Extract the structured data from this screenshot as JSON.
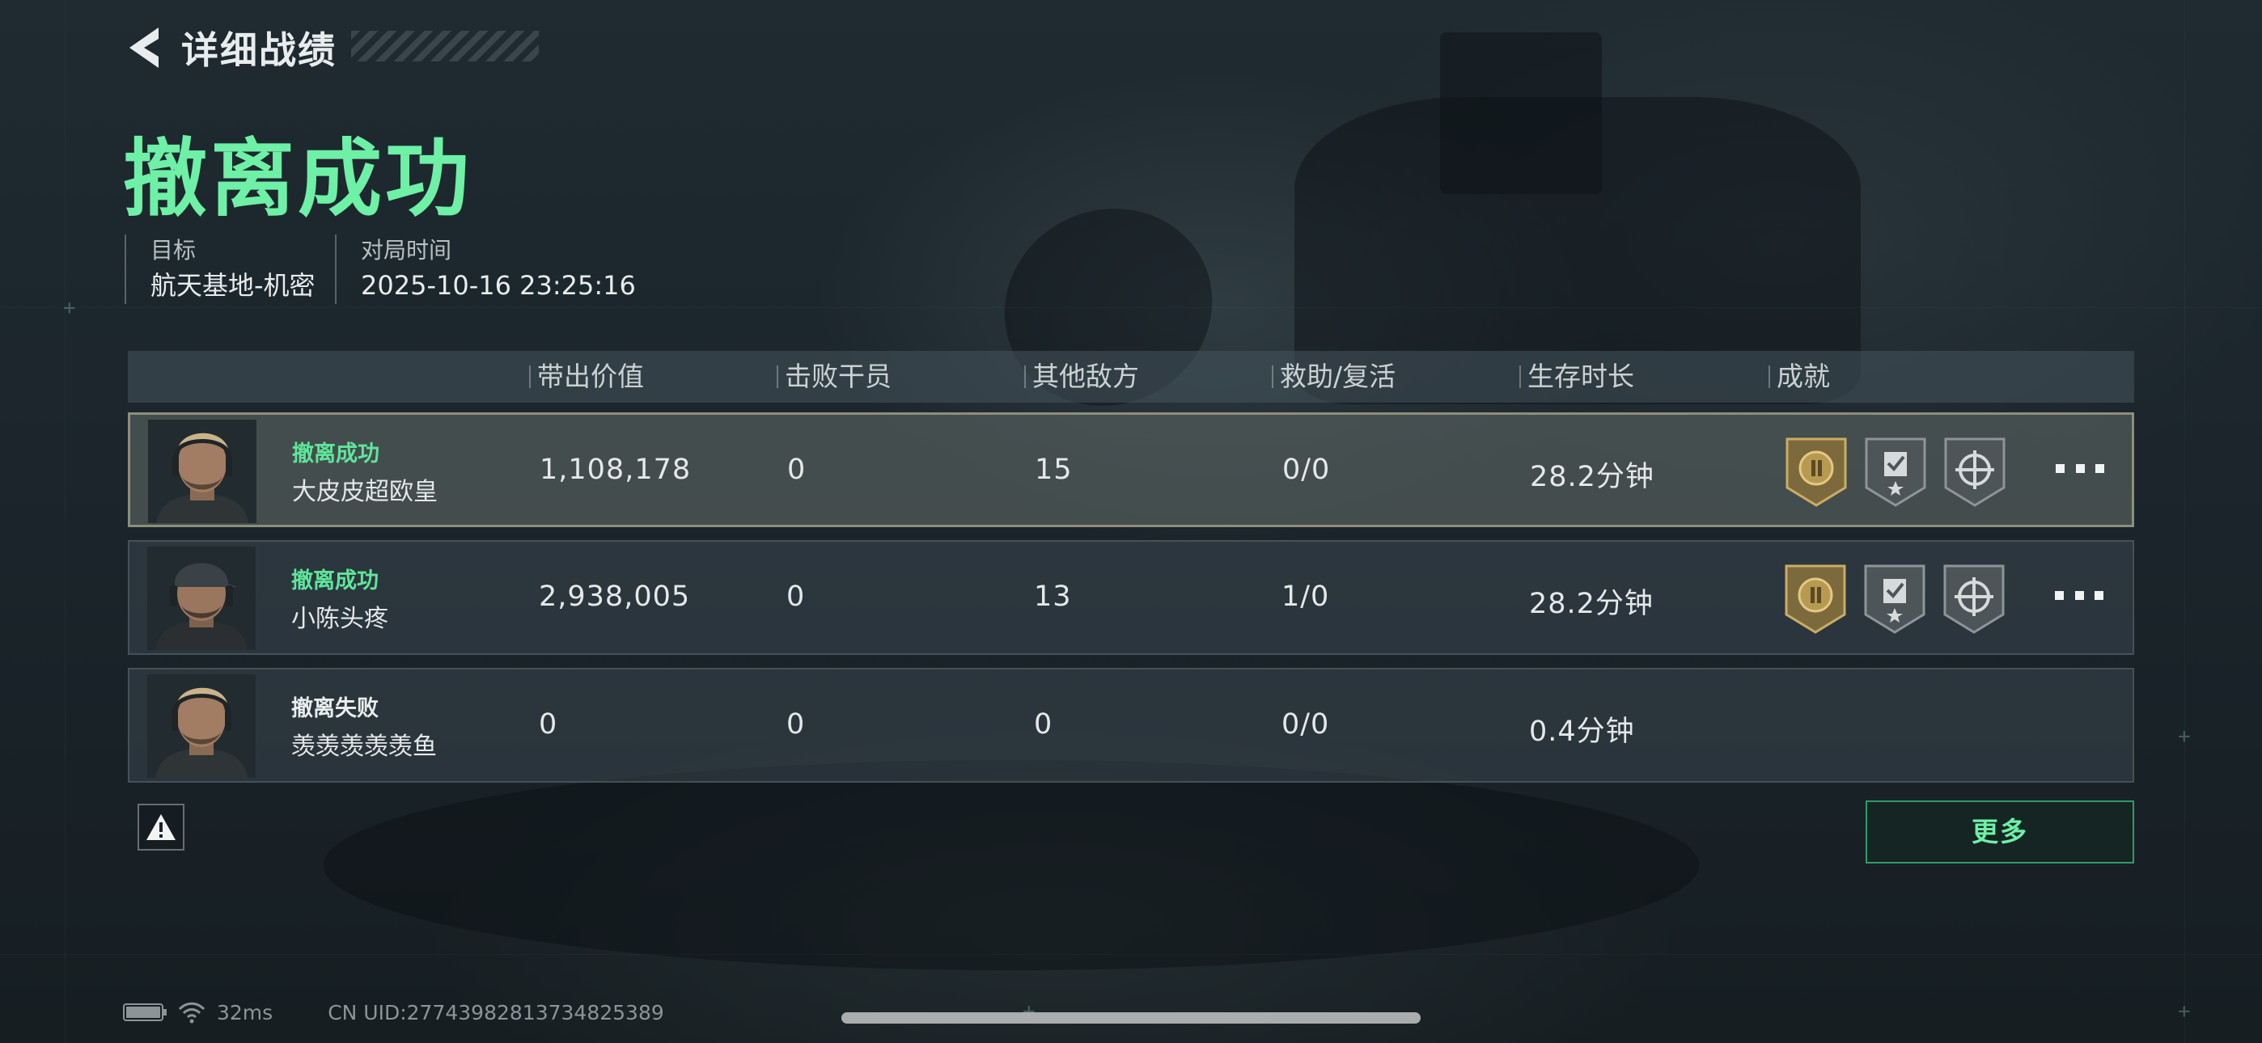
{
  "header": {
    "title": "详细战绩"
  },
  "result_title": "撤离成功",
  "meta": {
    "target_label": "目标",
    "target_value": "航天基地-机密",
    "time_label": "对局时间",
    "time_value": "2025-10-16 23:25:16"
  },
  "columns": [
    "带出价值",
    "击败干员",
    "其他敌方",
    "救助/复活",
    "生存时长",
    "成就"
  ],
  "rows": [
    {
      "status": "撤离成功",
      "status_type": "success",
      "name": "大皮皮超欧皇",
      "value": "1,108,178",
      "kills": "0",
      "other_enemies": "15",
      "assist_revive": "0/0",
      "survival": "28.2分钟",
      "achievements": [
        "gold-laurel-badge-icon",
        "checklist-star-badge-icon",
        "crosshair-badge-icon"
      ],
      "highlighted": true
    },
    {
      "status": "撤离成功",
      "status_type": "success",
      "name": "小陈头疼",
      "value": "2,938,005",
      "kills": "0",
      "other_enemies": "13",
      "assist_revive": "1/0",
      "survival": "28.2分钟",
      "achievements": [
        "gold-laurel-badge-icon",
        "checklist-star-badge-icon",
        "crosshair-badge-icon"
      ],
      "highlighted": false
    },
    {
      "status": "撤离失败",
      "status_type": "fail",
      "name": "羡羡羡羡羡鱼",
      "value": "0",
      "kills": "0",
      "other_enemies": "0",
      "assist_revive": "0/0",
      "survival": "0.4分钟",
      "achievements": [],
      "highlighted": false
    }
  ],
  "more_button": "更多",
  "footer": {
    "ping": "32ms",
    "uid": "CN UID:27743982813734825389"
  },
  "colors": {
    "accent_green": "#6ef0a6",
    "success_green": "#5fe59a",
    "highlight_border": "#8d8f7a"
  }
}
